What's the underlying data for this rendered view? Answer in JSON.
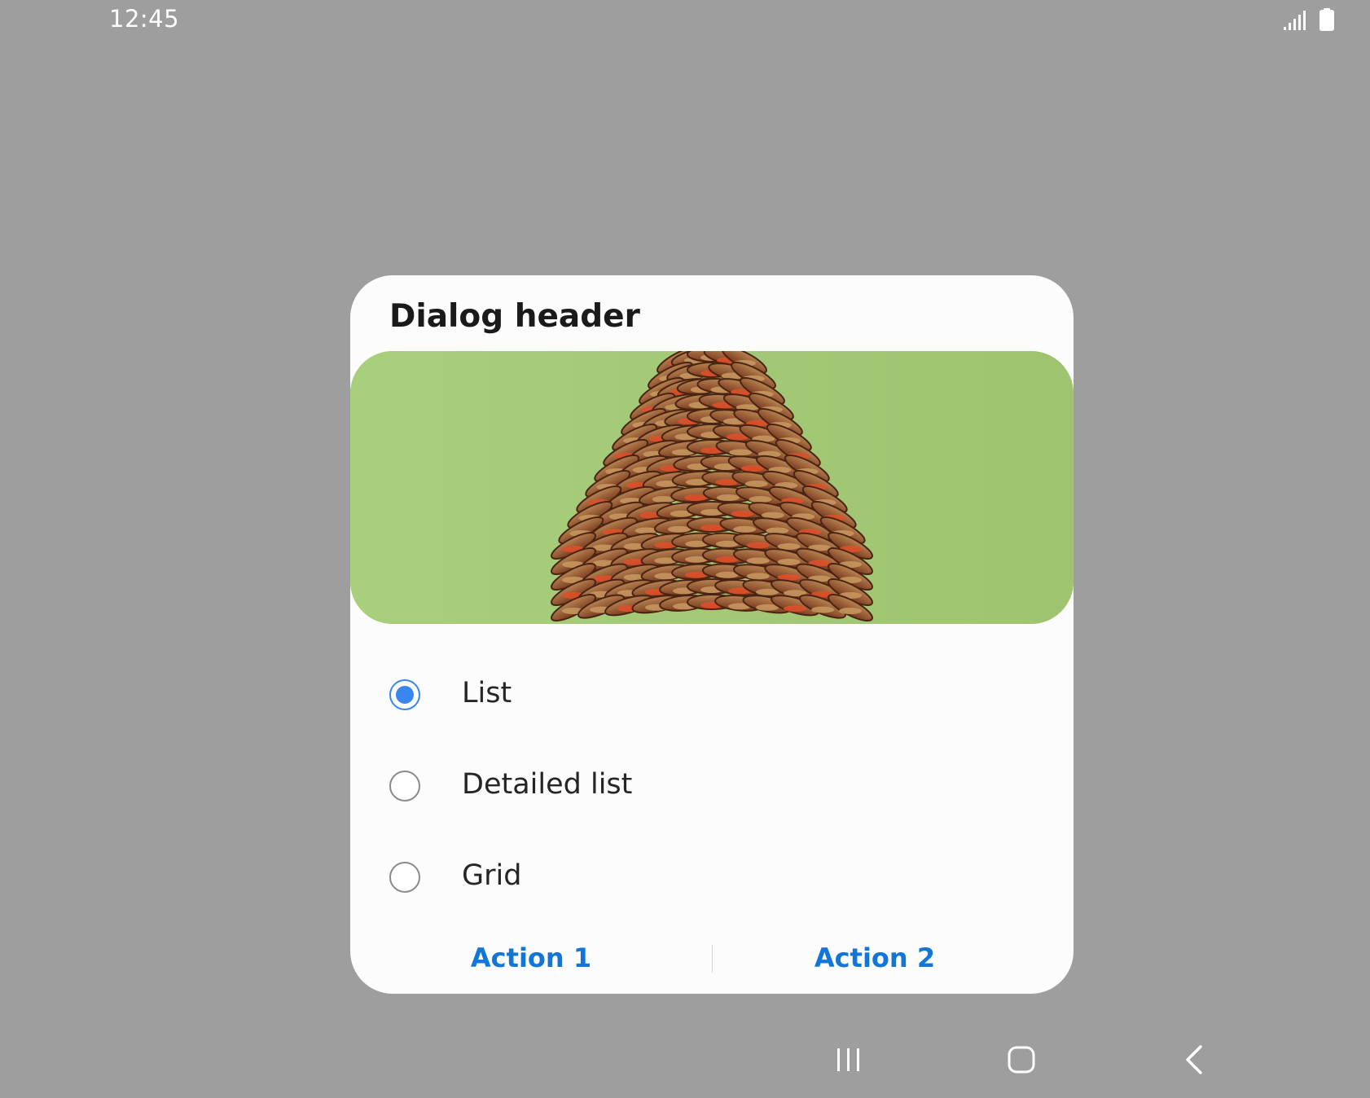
{
  "status_bar": {
    "time": "12:45",
    "icons": [
      "signal-icon",
      "battery-icon"
    ]
  },
  "dialog": {
    "header": "Dialog header",
    "image": "pinecone-image",
    "options": [
      {
        "label": "List",
        "selected": true
      },
      {
        "label": "Detailed list",
        "selected": false
      },
      {
        "label": "Grid",
        "selected": false
      }
    ],
    "actions": {
      "action1": "Action 1",
      "action2": "Action 2"
    }
  },
  "navigation_bar": {
    "icons": [
      "recents-icon",
      "home-icon",
      "back-icon"
    ]
  },
  "colors": {
    "scrim": "#9e9e9e",
    "dialog_bg": "#fcfcfc",
    "accent": "#1275d8",
    "radio_checked": "#3a86f0",
    "hero_bg": "#a5c978"
  }
}
